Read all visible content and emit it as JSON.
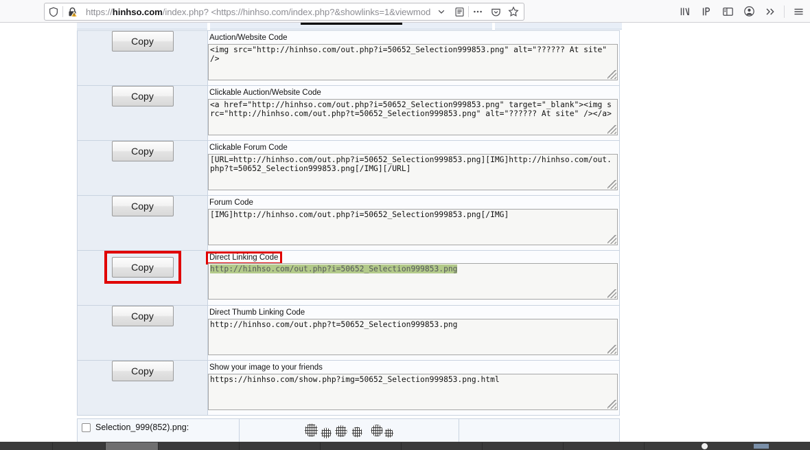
{
  "browser": {
    "url_prefix": "https://",
    "url_host": "hinhso.com",
    "url_rest": "/index.php? <https://hinhso.com/index.php?&showlinks=1&viewmod",
    "icons": {
      "shield": "shield-icon",
      "lock_warning": "lock-warning-icon",
      "dropdown": "chevron-down-icon",
      "reader": "reader-view-icon",
      "more": "page-actions-icon",
      "pocket": "pocket-icon",
      "bookmark": "bookmark-star-icon",
      "library": "library-icon",
      "ip_extension": "ip-extension-icon",
      "sidebar": "sidebar-icon",
      "account": "account-icon",
      "overflow": "overflow-chevrons-icon",
      "app_menu": "hamburger-menu-icon"
    }
  },
  "annotation": {
    "color": "#e00000",
    "targets": [
      "direct-linking-code-label",
      "direct-linking-copy-button"
    ]
  },
  "selection": {
    "highlight_color": "#b3ca8a",
    "text_color": "#55585a"
  },
  "copy_label": "Copy",
  "rows": [
    {
      "label": "Auction/Website Code",
      "value": "<img src=\"http://hinhso.com/out.php?i=50652_Selection999853.png\" alt=\"?????? At site\" />",
      "highlighted": false,
      "annotated": false
    },
    {
      "label": "Clickable Auction/Website Code",
      "value": "<a href=\"http://hinhso.com/out.php?i=50652_Selection999853.png\" target=\"_blank\"><img src=\"http://hinhso.com/out.php?t=50652_Selection999853.png\" alt=\"?????? At site\" /></a>",
      "highlighted": false,
      "annotated": false
    },
    {
      "label": "Clickable Forum Code",
      "value": "[URL=http://hinhso.com/out.php?i=50652_Selection999853.png][IMG]http://hinhso.com/out.php?t=50652_Selection999853.png[/IMG][/URL]",
      "highlighted": false,
      "annotated": false
    },
    {
      "label": "Forum Code",
      "value": "[IMG]http://hinhso.com/out.php?i=50652_Selection999853.png[/IMG]",
      "highlighted": false,
      "annotated": false
    },
    {
      "label": "Direct Linking Code",
      "value": "http://hinhso.com/out.php?i=50652_Selection999853.png",
      "highlighted": true,
      "annotated": true
    },
    {
      "label": "Direct Thumb Linking Code",
      "value": "http://hinhso.com/out.php?t=50652_Selection999853.png",
      "highlighted": false,
      "annotated": false
    },
    {
      "label": "Show your image to your friends",
      "value": "https://hinhso.com/show.php?img=50652_Selection999853.png.html",
      "highlighted": false,
      "annotated": false
    }
  ],
  "file_row": {
    "name": "Selection_999(852).png:",
    "checked": false,
    "thumbnail": "image-thumbnail"
  }
}
